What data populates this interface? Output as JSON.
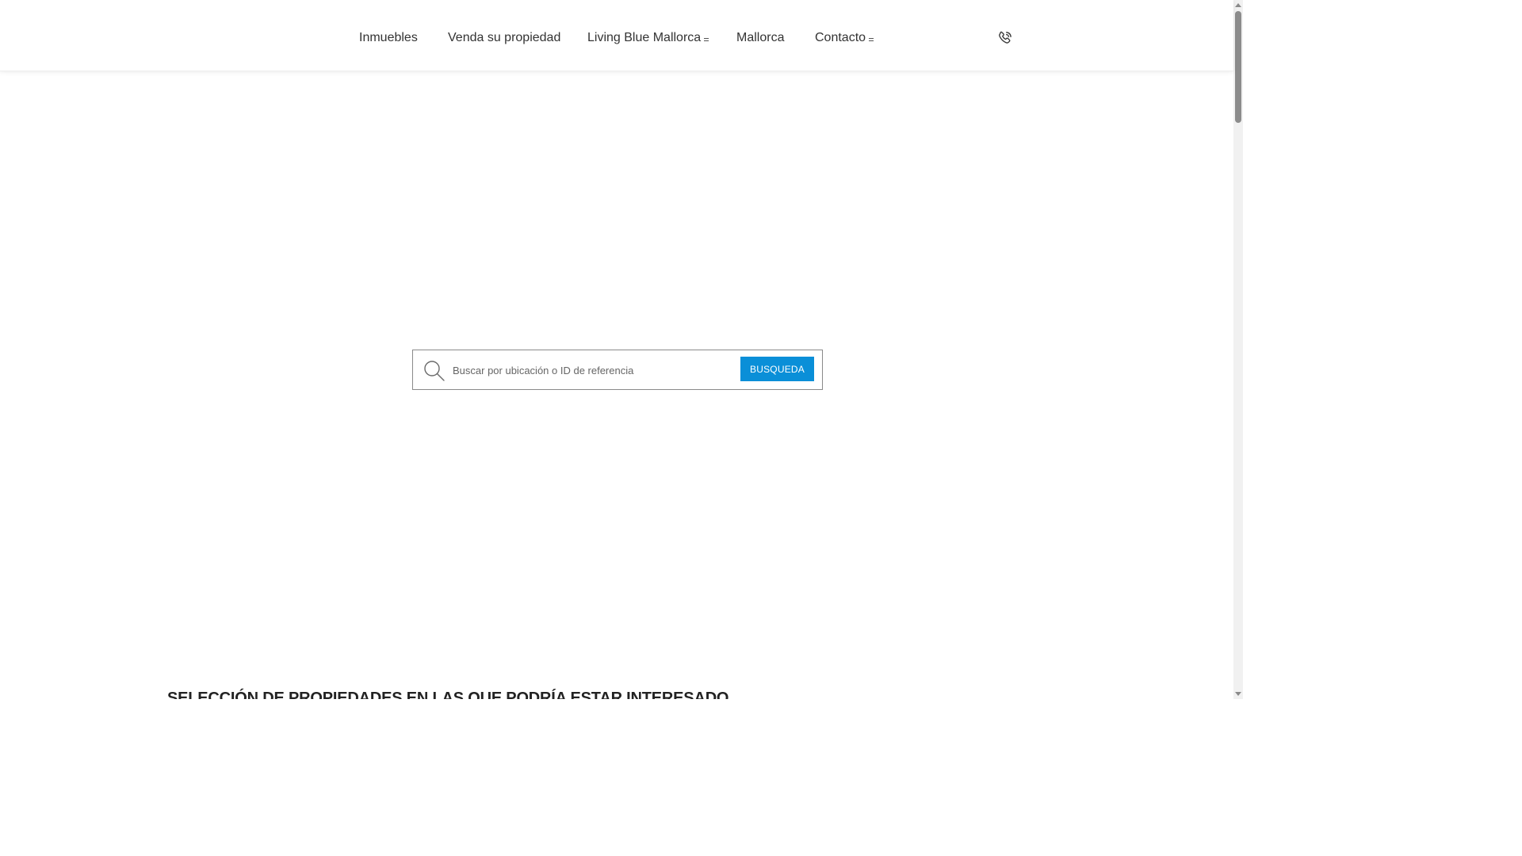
{
  "nav": {
    "items": [
      {
        "label": "Inmuebles",
        "has_dropdown": false
      },
      {
        "label": "Venda su propiedad",
        "has_dropdown": false
      },
      {
        "label": "Living Blue Mallorca",
        "has_dropdown": true
      },
      {
        "label": "Mallorca",
        "has_dropdown": false
      },
      {
        "label": "Contacto",
        "has_dropdown": true
      }
    ],
    "phone_icon": "phone-icon"
  },
  "search": {
    "placeholder": "Buscar por ubicación o ID de referencia",
    "value": "",
    "button_label": "BUSQUEDA",
    "icon": "search-icon",
    "button_color": "#0a8fd8"
  },
  "section": {
    "title": "SELECCIÓN DE PROPIEDADES EN LAS QUE PODRÍA ESTAR INTERESADO"
  }
}
